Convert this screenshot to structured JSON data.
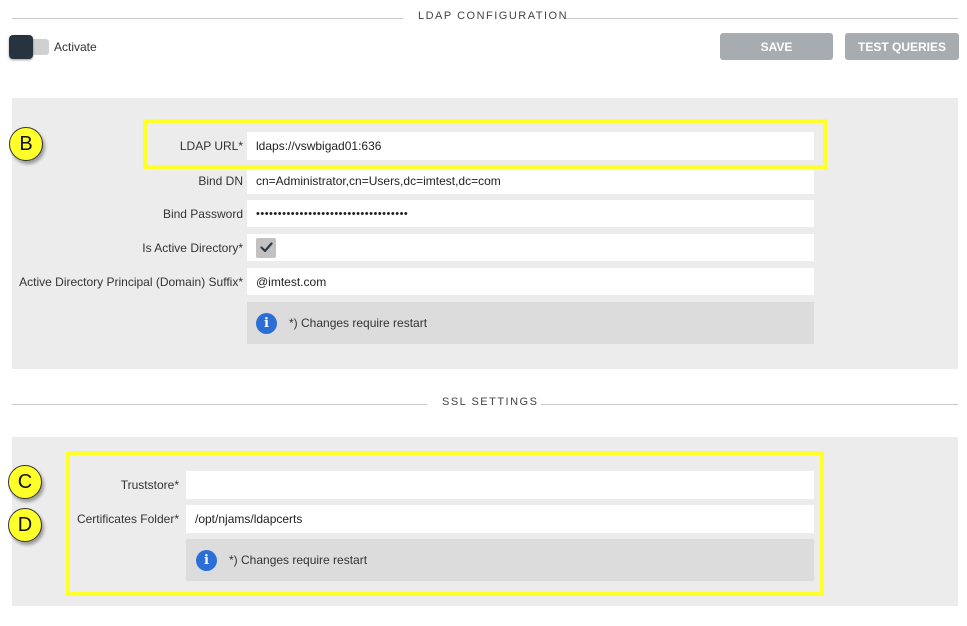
{
  "ldap_section": {
    "title": "LDAP CONFIGURATION",
    "activate_label": "Activate",
    "save_label": "SAVE",
    "test_label": "TEST QUERIES",
    "fields": {
      "url_label": "LDAP URL*",
      "url_value": "ldaps://vswbigad01:636",
      "bind_dn_label": "Bind DN",
      "bind_dn_value": "cn=Administrator,cn=Users,dc=imtest,dc=com",
      "bind_password_label": "Bind Password",
      "bind_password_value": "•••••••••••••••••••••••••••••••••••",
      "is_ad_label": "Is Active Directory*",
      "is_ad_checked": true,
      "ad_suffix_label": "Active Directory Principal (Domain) Suffix*",
      "ad_suffix_value": "@imtest.com"
    },
    "info_text": "*) Changes require restart"
  },
  "ssl_section": {
    "title": "SSL SETTINGS",
    "truststore_label": "Truststore*",
    "truststore_value": "",
    "certs_label": "Certificates Folder*",
    "certs_value": "/opt/njams/ldapcerts",
    "info_text": "*) Changes require restart"
  },
  "annotations": {
    "b": "B",
    "c": "C",
    "d": "D",
    "highlight_color": "#ffff2a"
  },
  "icons": {
    "info": "info-icon",
    "check": "check-icon"
  },
  "info_glyph": "i",
  "colors": {
    "panel_bg": "#ececec",
    "button_bg": "#a7acb0",
    "info_blue": "#2b6fd6",
    "toggle_knob": "#27343f"
  }
}
